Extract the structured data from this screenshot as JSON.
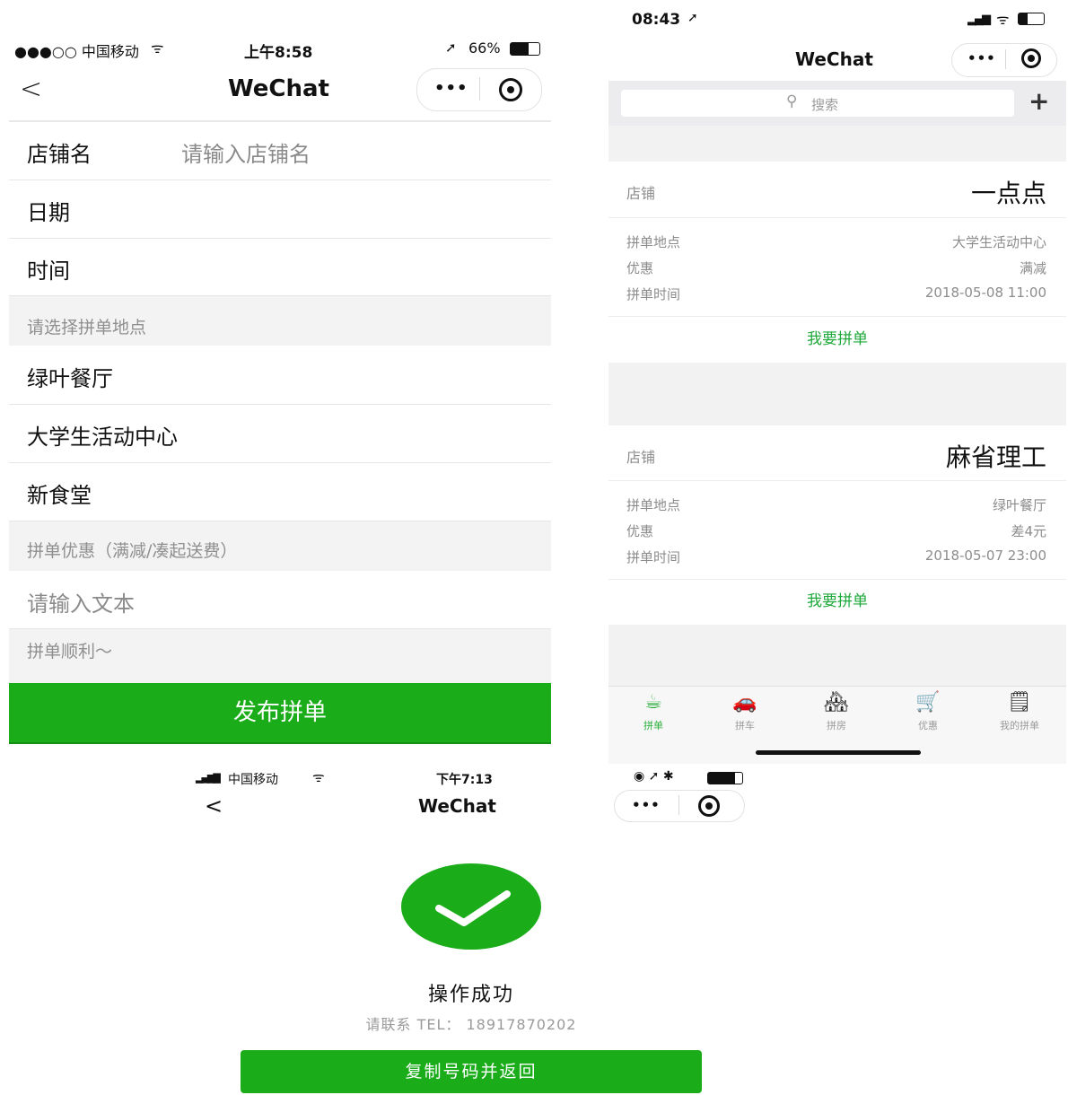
{
  "left_phone": {
    "status": {
      "carrier": "●●●○○ 中国移动",
      "time": "上午8:58",
      "battery": "66%"
    },
    "nav": {
      "title": "WeChat",
      "more": "•••"
    },
    "form": {
      "shop_label": "店铺名",
      "shop_placeholder": "请输入店铺名",
      "date_label": "日期",
      "time_label": "时间",
      "location_header": "请选择拼单地点",
      "locations": [
        "绿叶餐厅",
        "大学生活动中心",
        "新食堂"
      ],
      "discount_header": "拼单优惠（满减/凑起送费）",
      "discount_placeholder": "请输入文本",
      "note": "拼单顺利～",
      "submit": "发布拼单"
    }
  },
  "right_phone": {
    "status": {
      "time": "08:43"
    },
    "nav": {
      "title": "WeChat",
      "more": "•••"
    },
    "search": {
      "placeholder": "搜索",
      "add": "+"
    },
    "cards": [
      {
        "shop_label": "店铺",
        "shop": "一点点",
        "loc_label": "拼单地点",
        "loc": "大学生活动中心",
        "disc_label": "优惠",
        "disc": "满减",
        "time_label": "拼单时间",
        "time": "2018-05-08 11:00",
        "action": "我要拼单"
      },
      {
        "shop_label": "店铺",
        "shop": "麻省理工",
        "loc_label": "拼单地点",
        "loc": "绿叶餐厅",
        "disc_label": "优惠",
        "disc": "差4元",
        "time_label": "拼单时间",
        "time": "2018-05-07 23:00",
        "action": "我要拼单"
      }
    ],
    "tabs": [
      "拼单",
      "拼车",
      "拼房",
      "优惠",
      "我的拼单"
    ],
    "active_tab_color": "#2aae3a"
  },
  "bottom_phone": {
    "status": {
      "carrier": "中国移动",
      "time": "下午7:13"
    },
    "nav": {
      "title": "WeChat",
      "back": "<",
      "more": "•••"
    },
    "result": {
      "title": "操作成功",
      "contact": "请联系 TEL： 18917870202",
      "button": "复制号码并返回"
    }
  },
  "colors": {
    "green": "#1aad19",
    "green_text": "#1fa93b",
    "gray_bg": "#f3f3f3"
  }
}
